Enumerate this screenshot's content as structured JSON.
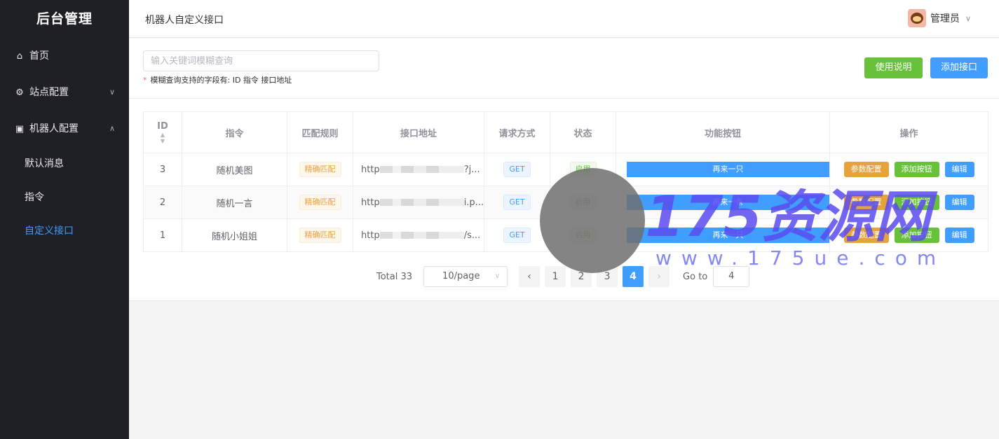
{
  "sidebar": {
    "logo": "后台管理",
    "items": [
      {
        "label": "首页"
      },
      {
        "label": "站点配置"
      },
      {
        "label": "机器人配置"
      }
    ],
    "sub_items": [
      {
        "label": "默认消息"
      },
      {
        "label": "指令"
      },
      {
        "label": "自定义接口"
      }
    ]
  },
  "header": {
    "title": "机器人自定义接口",
    "user_name": "管理员"
  },
  "toolbar": {
    "search_placeholder": "输入关键词模糊查询",
    "hint_star": "*",
    "hint": "模糊查询支持的字段有: ID 指令 接口地址",
    "help_label": "使用说明",
    "add_label": "添加接口"
  },
  "table": {
    "headers": [
      "ID",
      "指令",
      "匹配规则",
      "接口地址",
      "请求方式",
      "状态",
      "功能按钮",
      "操作"
    ],
    "rows": [
      {
        "id": "3",
        "command": "随机美图",
        "rule": "精确匹配",
        "url_start": "http",
        "url_end": "?j...",
        "method": "GET",
        "status": "启用",
        "function": "再来一只",
        "op1": "参数配置",
        "op2": "添加按钮",
        "op3": "编辑"
      },
      {
        "id": "2",
        "command": "随机一言",
        "rule": "精确匹配",
        "url_start": "http",
        "url_end": "i.p...",
        "method": "GET",
        "status": "启用",
        "function": "再来一条",
        "op1": "参数配置",
        "op2": "添加按钮",
        "op3": "编辑"
      },
      {
        "id": "1",
        "command": "随机小姐姐",
        "rule": "精确匹配",
        "url_start": "http",
        "url_end": "/s...",
        "method": "GET",
        "status": "启用",
        "function": "再来一只",
        "op1": "参数配置",
        "op2": "添加按钮",
        "op3": "编辑"
      }
    ]
  },
  "pagination": {
    "total": "Total 33",
    "page_size": "10/page",
    "pages": [
      "1",
      "2",
      "3",
      "4"
    ],
    "current": "4",
    "goto_label": "Go to",
    "goto_value": "4"
  },
  "watermark": {
    "brand": "175资源网",
    "url": "www.175ue.com"
  }
}
